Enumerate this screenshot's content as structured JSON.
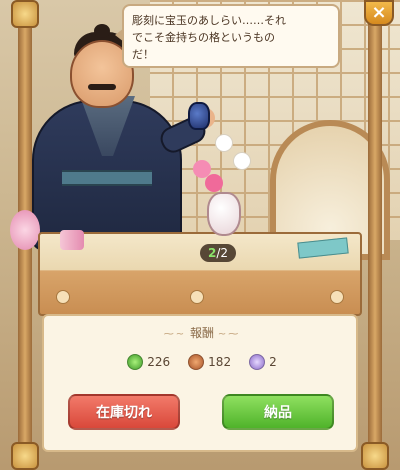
{
  "dialog": {
    "line1": "彫刻に宝玉のあしらい……それ",
    "line2": "でこそ金持ちの格というもの",
    "line3": "だ！"
  },
  "counter": {
    "current": "2",
    "total": "/2"
  },
  "reward": {
    "title": "報酬",
    "items": [
      {
        "icon": "green-gem-icon",
        "value": "226",
        "color": "#5fb845"
      },
      {
        "icon": "copper-coin-icon",
        "value": "182",
        "color": "#c8743a"
      },
      {
        "icon": "purple-orb-icon",
        "value": "2",
        "color": "#a58ad8"
      }
    ]
  },
  "buttons": {
    "out_of_stock": "在庫切れ",
    "deliver": "納品"
  },
  "window": {
    "close_label": "×"
  },
  "colors": {
    "out_button": "#e0584a",
    "deliver_button": "#6fcb42",
    "panel_bg": "#fbf4e4"
  }
}
